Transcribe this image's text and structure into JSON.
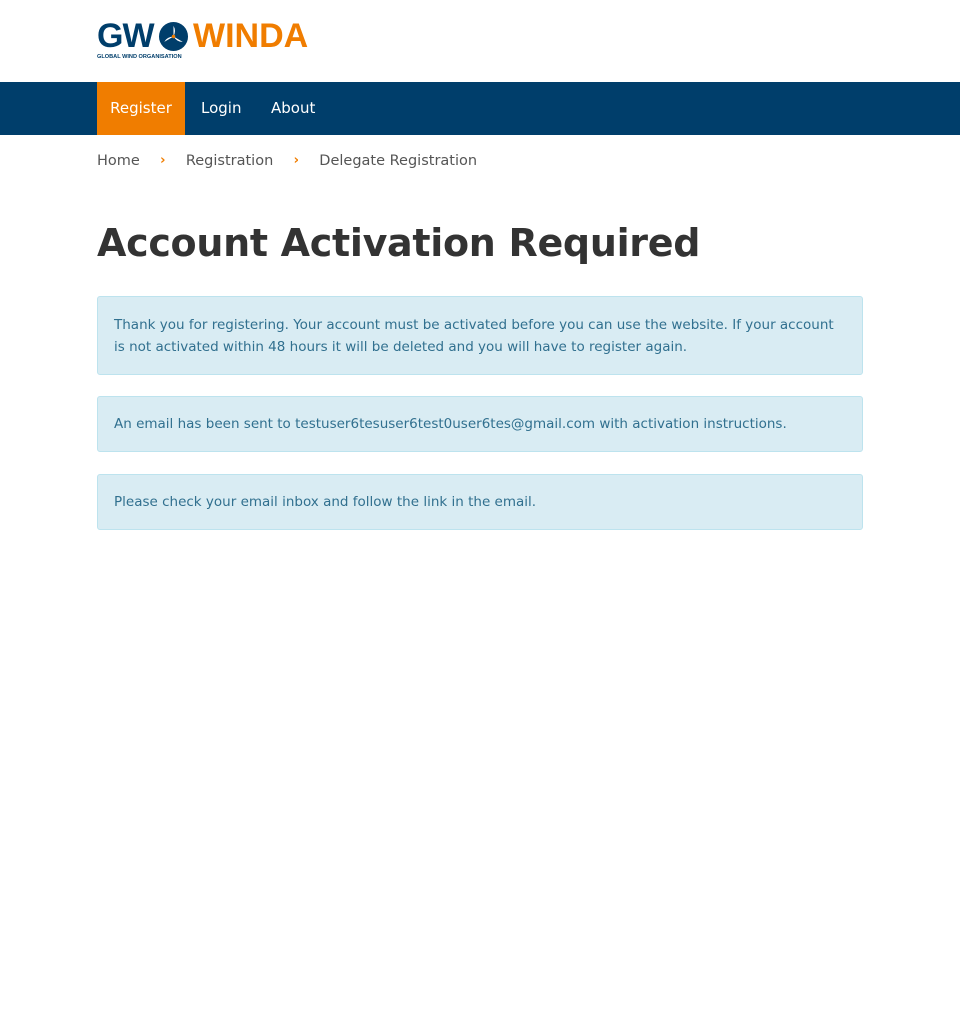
{
  "brand": {
    "logo_left": "GW",
    "logo_right": "WINDA",
    "logo_subtitle": "GLOBAL WIND ORGANISATION",
    "colors": {
      "navy": "#003e6b",
      "orange": "#f07d00"
    }
  },
  "nav": {
    "items": [
      {
        "label": "Register",
        "active": true
      },
      {
        "label": "Login",
        "active": false
      },
      {
        "label": "About",
        "active": false
      }
    ]
  },
  "breadcrumb": {
    "items": [
      "Home",
      "Registration",
      "Delegate Registration"
    ],
    "separator": "›"
  },
  "page": {
    "title": "Account Activation Required"
  },
  "alerts": [
    "Thank you for registering. Your account must be activated before you can use the website. If your account is not activated within 48 hours it will be deleted and you will have to register again.",
    "An email has been sent to testuser6tesuser6test0user6tes@gmail.com with activation instructions.",
    "Please check your email inbox and follow the link in the email."
  ]
}
